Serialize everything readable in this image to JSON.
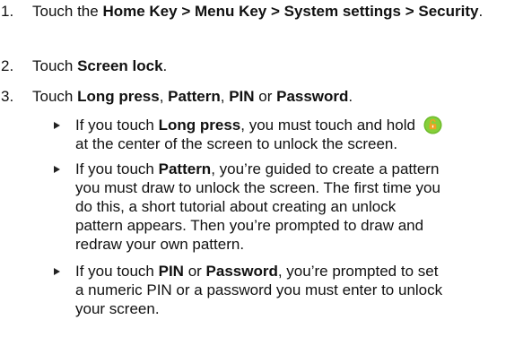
{
  "steps": [
    {
      "number": "1.",
      "prefix": "Touch the ",
      "bold": "Home Key > Menu Key > System settings > Security",
      "suffix": "."
    },
    {
      "number": "2.",
      "prefix": "Touch ",
      "bold": "Screen lock",
      "suffix": "."
    },
    {
      "number": "3.",
      "prefix": "Touch ",
      "opt1": "Long press",
      "sep1": ", ",
      "opt2": "Pattern",
      "sep2": ", ",
      "opt3": "PIN",
      "sep3": " or ",
      "opt4": "Password",
      "suffix": "."
    }
  ],
  "bullets": [
    {
      "prefix": "If you touch ",
      "bold": "Long press",
      "text1": ", you must touch and hold",
      "icon": "unlock-icon",
      "text2": "at the center of the screen to unlock the screen."
    },
    {
      "prefix": "If you touch ",
      "bold": "Pattern",
      "lines": [
        ", you’re guided to create a pattern",
        "you must draw to unlock the screen. The first time you",
        "do this, a short tutorial about creating an unlock",
        "pattern appears. Then you’re prompted to draw and",
        "redraw your own pattern."
      ]
    },
    {
      "prefix": "If you touch ",
      "bold1": "PIN",
      "mid": " or ",
      "bold2": "Password",
      "lines": [
        ", you’re prompted to set",
        "a numeric PIN or a password you must enter to unlock",
        "your screen."
      ]
    }
  ],
  "colors": {
    "icon_green": "#6dbb2b",
    "icon_orange": "#f0a024"
  }
}
